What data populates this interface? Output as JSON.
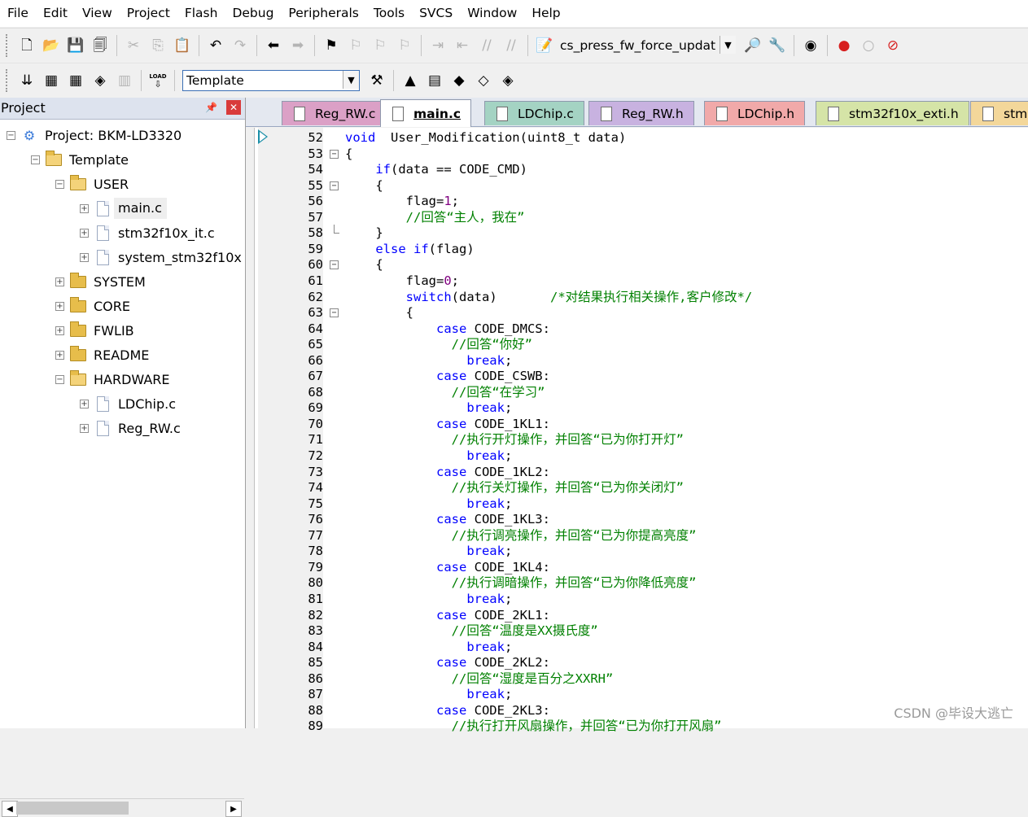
{
  "menu": [
    "File",
    "Edit",
    "View",
    "Project",
    "Flash",
    "Debug",
    "Peripherals",
    "Tools",
    "SVCS",
    "Window",
    "Help"
  ],
  "toolbar1": {
    "buttons1": [
      {
        "name": "new-file",
        "glyph": "🗋"
      },
      {
        "name": "open-folder",
        "glyph": "📂"
      },
      {
        "name": "save",
        "glyph": "💾"
      },
      {
        "name": "save-all",
        "glyph": "🗐"
      }
    ],
    "buttons2": [
      {
        "name": "cut",
        "glyph": "✂",
        "dim": true
      },
      {
        "name": "copy",
        "glyph": "⎘",
        "dim": true
      },
      {
        "name": "paste",
        "glyph": "📋"
      }
    ],
    "buttons3": [
      {
        "name": "undo",
        "glyph": "↶"
      },
      {
        "name": "redo",
        "glyph": "↷",
        "dim": true
      }
    ],
    "buttons4": [
      {
        "name": "navigate-back",
        "glyph": "⬅"
      },
      {
        "name": "navigate-forward",
        "glyph": "➡",
        "dim": true
      }
    ],
    "buttons5": [
      {
        "name": "bookmark-insert",
        "glyph": "⚑"
      },
      {
        "name": "bookmark-prev",
        "glyph": "⚐",
        "dim": true
      },
      {
        "name": "bookmark-next",
        "glyph": "⚐",
        "dim": true
      },
      {
        "name": "bookmark-clear",
        "glyph": "⚐",
        "dim": true
      }
    ],
    "buttons6": [
      {
        "name": "indent",
        "glyph": "⇥",
        "dim": true
      },
      {
        "name": "unindent",
        "glyph": "⇤",
        "dim": true
      },
      {
        "name": "comment",
        "glyph": "//",
        "dim": true
      },
      {
        "name": "uncomment",
        "glyph": "//",
        "dim": true
      }
    ],
    "build_combo_value": "cs_press_fw_force_updat",
    "buttons7": [
      {
        "name": "find-in-files",
        "glyph": "🔎"
      },
      {
        "name": "configure",
        "glyph": "🔧"
      }
    ],
    "buttons8": [
      {
        "name": "debug-session",
        "glyph": "◉"
      }
    ],
    "buttons9": [
      {
        "name": "insert-breakpoint",
        "glyph": "●",
        "color": "#d71f1f"
      },
      {
        "name": "enable-breakpoint",
        "glyph": "○",
        "dim": true
      },
      {
        "name": "kill-breakpoints",
        "glyph": "⊘",
        "color": "#d71f1f"
      }
    ]
  },
  "toolbar2": {
    "buttons1": [
      {
        "name": "translate",
        "glyph": "⇊"
      },
      {
        "name": "build",
        "glyph": "▦"
      },
      {
        "name": "rebuild",
        "glyph": "▦"
      },
      {
        "name": "batch-build",
        "glyph": "◈"
      },
      {
        "name": "stop-build",
        "glyph": "▥",
        "dim": true
      }
    ],
    "buttons2": [
      {
        "name": "download",
        "glyph": "⇩",
        "label": "LOAD"
      }
    ],
    "target_value": "Template",
    "buttons3": [
      {
        "name": "target-options",
        "glyph": "⚒"
      }
    ],
    "buttons4": [
      {
        "name": "manage-components",
        "glyph": "▲"
      },
      {
        "name": "file-extensions",
        "glyph": "▤"
      },
      {
        "name": "run-time-environment",
        "glyph": "◆"
      },
      {
        "name": "pack-installer",
        "glyph": "◇"
      },
      {
        "name": "select-packs",
        "glyph": "◈"
      }
    ]
  },
  "project_panel": {
    "title": "Project",
    "tree": [
      {
        "label": "Project: BKM-LD3320",
        "type": "project",
        "level": 0,
        "expander": "⊟"
      },
      {
        "label": "Template",
        "type": "target",
        "level": 1,
        "expander": "⊟"
      },
      {
        "label": "USER",
        "type": "folder-open",
        "level": 2,
        "expander": "⊟"
      },
      {
        "label": "main.c",
        "type": "file",
        "level": 3,
        "expander": "⊞",
        "selected": true
      },
      {
        "label": "stm32f10x_it.c",
        "type": "file",
        "level": 3,
        "expander": "⊞"
      },
      {
        "label": "system_stm32f10x",
        "type": "file",
        "level": 3,
        "expander": "⊞"
      },
      {
        "label": "SYSTEM",
        "type": "folder",
        "level": 2,
        "expander": "⊞"
      },
      {
        "label": "CORE",
        "type": "folder",
        "level": 2,
        "expander": "⊞"
      },
      {
        "label": "FWLIB",
        "type": "folder",
        "level": 2,
        "expander": "⊞"
      },
      {
        "label": "README",
        "type": "folder",
        "level": 2,
        "expander": "⊞"
      },
      {
        "label": "HARDWARE",
        "type": "folder-open",
        "level": 2,
        "expander": "⊟"
      },
      {
        "label": "LDChip.c",
        "type": "file",
        "level": 3,
        "expander": "⊞"
      },
      {
        "label": "Reg_RW.c",
        "type": "file",
        "level": 3,
        "expander": "⊞"
      }
    ]
  },
  "tabs": [
    {
      "label": "Reg_RW.c",
      "color": "#dba0c6",
      "active": false
    },
    {
      "label": "main.c",
      "color": "#ffffff",
      "active": true
    },
    {
      "label": "LDChip.c",
      "color": "#a4d3c3",
      "active": false
    },
    {
      "label": "Reg_RW.h",
      "color": "#c8b2e0",
      "active": false
    },
    {
      "label": "LDChip.h",
      "color": "#f1a9a9",
      "active": false
    },
    {
      "label": "stm32f10x_exti.h",
      "color": "#d5e4a7",
      "active": false
    },
    {
      "label": "stm",
      "color": "#f3d79a",
      "active": false
    }
  ],
  "editor": {
    "lines": [
      {
        "n": "52",
        "fold": "",
        "segs": [
          [
            "kw",
            "void"
          ],
          [
            "",
            "  User_Modification(uint8_t data)"
          ]
        ]
      },
      {
        "n": "53",
        "fold": "box",
        "segs": [
          [
            "",
            "{"
          ]
        ]
      },
      {
        "n": "54",
        "fold": "",
        "segs": [
          [
            "",
            "    "
          ],
          [
            "kw",
            "if"
          ],
          [
            "",
            "(data == CODE_CMD)"
          ]
        ]
      },
      {
        "n": "55",
        "fold": "box",
        "segs": [
          [
            "",
            "    {"
          ]
        ]
      },
      {
        "n": "56",
        "fold": "",
        "segs": [
          [
            "",
            "        flag="
          ],
          [
            "nm",
            "1"
          ],
          [
            "",
            ";"
          ]
        ]
      },
      {
        "n": "57",
        "fold": "",
        "segs": [
          [
            "",
            "        "
          ],
          [
            "cm",
            "//回答“主人，我在”"
          ]
        ]
      },
      {
        "n": "58",
        "fold": "end",
        "segs": [
          [
            "",
            "    }"
          ]
        ]
      },
      {
        "n": "59",
        "fold": "",
        "segs": [
          [
            "",
            "    "
          ],
          [
            "kw",
            "else"
          ],
          [
            "",
            " "
          ],
          [
            "kw",
            "if"
          ],
          [
            "",
            "(flag)"
          ]
        ]
      },
      {
        "n": "60",
        "fold": "box",
        "segs": [
          [
            "",
            "    {"
          ]
        ]
      },
      {
        "n": "61",
        "fold": "",
        "segs": [
          [
            "",
            "        flag="
          ],
          [
            "nm",
            "0"
          ],
          [
            "",
            ";"
          ]
        ]
      },
      {
        "n": "62",
        "fold": "",
        "segs": [
          [
            "",
            "        "
          ],
          [
            "kw",
            "switch"
          ],
          [
            "",
            "(data)       "
          ],
          [
            "cm",
            "/*对结果执行相关操作,客户修改*/"
          ]
        ]
      },
      {
        "n": "63",
        "fold": "box",
        "segs": [
          [
            "",
            "        {"
          ]
        ]
      },
      {
        "n": "64",
        "fold": "",
        "segs": [
          [
            "",
            "            "
          ],
          [
            "kw",
            "case"
          ],
          [
            "",
            " CODE_DMCS:"
          ]
        ]
      },
      {
        "n": "65",
        "fold": "",
        "segs": [
          [
            "",
            "              "
          ],
          [
            "cm",
            "//回答“你好”"
          ]
        ]
      },
      {
        "n": "66",
        "fold": "",
        "segs": [
          [
            "",
            "                "
          ],
          [
            "kw",
            "break"
          ],
          [
            "",
            ";"
          ]
        ]
      },
      {
        "n": "67",
        "fold": "",
        "segs": [
          [
            "",
            "            "
          ],
          [
            "kw",
            "case"
          ],
          [
            "",
            " CODE_CSWB:"
          ]
        ]
      },
      {
        "n": "68",
        "fold": "",
        "segs": [
          [
            "",
            "              "
          ],
          [
            "cm",
            "//回答“在学习”"
          ]
        ]
      },
      {
        "n": "69",
        "fold": "",
        "segs": [
          [
            "",
            "                "
          ],
          [
            "kw",
            "break"
          ],
          [
            "",
            ";"
          ]
        ]
      },
      {
        "n": "70",
        "fold": "",
        "segs": [
          [
            "",
            "            "
          ],
          [
            "kw",
            "case"
          ],
          [
            "",
            " CODE_1KL1:"
          ]
        ]
      },
      {
        "n": "71",
        "fold": "",
        "segs": [
          [
            "",
            "              "
          ],
          [
            "cm",
            "//执行开灯操作，并回答“已为你打开灯”"
          ]
        ]
      },
      {
        "n": "72",
        "fold": "",
        "segs": [
          [
            "",
            "                "
          ],
          [
            "kw",
            "break"
          ],
          [
            "",
            ";"
          ]
        ]
      },
      {
        "n": "73",
        "fold": "",
        "segs": [
          [
            "",
            "            "
          ],
          [
            "kw",
            "case"
          ],
          [
            "",
            " CODE_1KL2:"
          ]
        ]
      },
      {
        "n": "74",
        "fold": "",
        "segs": [
          [
            "",
            "              "
          ],
          [
            "cm",
            "//执行关灯操作，并回答“已为你关闭灯”"
          ]
        ]
      },
      {
        "n": "75",
        "fold": "",
        "segs": [
          [
            "",
            "                "
          ],
          [
            "kw",
            "break"
          ],
          [
            "",
            ";"
          ]
        ]
      },
      {
        "n": "76",
        "fold": "",
        "segs": [
          [
            "",
            "            "
          ],
          [
            "kw",
            "case"
          ],
          [
            "",
            " CODE_1KL3:"
          ]
        ]
      },
      {
        "n": "77",
        "fold": "",
        "segs": [
          [
            "",
            "              "
          ],
          [
            "cm",
            "//执行调亮操作，并回答“已为你提高亮度”"
          ]
        ]
      },
      {
        "n": "78",
        "fold": "",
        "segs": [
          [
            "",
            "                "
          ],
          [
            "kw",
            "break"
          ],
          [
            "",
            ";"
          ]
        ]
      },
      {
        "n": "79",
        "fold": "",
        "segs": [
          [
            "",
            "            "
          ],
          [
            "kw",
            "case"
          ],
          [
            "",
            " CODE_1KL4:"
          ]
        ]
      },
      {
        "n": "80",
        "fold": "",
        "segs": [
          [
            "",
            "              "
          ],
          [
            "cm",
            "//执行调暗操作，并回答“已为你降低亮度”"
          ]
        ]
      },
      {
        "n": "81",
        "fold": "",
        "segs": [
          [
            "",
            "                "
          ],
          [
            "kw",
            "break"
          ],
          [
            "",
            ";"
          ]
        ]
      },
      {
        "n": "82",
        "fold": "",
        "segs": [
          [
            "",
            "            "
          ],
          [
            "kw",
            "case"
          ],
          [
            "",
            " CODE_2KL1:"
          ]
        ]
      },
      {
        "n": "83",
        "fold": "",
        "segs": [
          [
            "",
            "              "
          ],
          [
            "cm",
            "//回答“温度是XX摄氏度”"
          ]
        ]
      },
      {
        "n": "84",
        "fold": "",
        "segs": [
          [
            "",
            "                "
          ],
          [
            "kw",
            "break"
          ],
          [
            "",
            ";"
          ]
        ]
      },
      {
        "n": "85",
        "fold": "",
        "segs": [
          [
            "",
            "            "
          ],
          [
            "kw",
            "case"
          ],
          [
            "",
            " CODE_2KL2:"
          ]
        ]
      },
      {
        "n": "86",
        "fold": "",
        "segs": [
          [
            "",
            "              "
          ],
          [
            "cm",
            "//回答“湿度是百分之XXRH”"
          ]
        ]
      },
      {
        "n": "87",
        "fold": "",
        "segs": [
          [
            "",
            "                "
          ],
          [
            "kw",
            "break"
          ],
          [
            "",
            ";"
          ]
        ]
      },
      {
        "n": "88",
        "fold": "",
        "segs": [
          [
            "",
            "            "
          ],
          [
            "kw",
            "case"
          ],
          [
            "",
            " CODE_2KL3:"
          ]
        ]
      },
      {
        "n": "89",
        "fold": "",
        "segs": [
          [
            "",
            "              "
          ],
          [
            "cm",
            "//执行打开风扇操作，并回答“已为你打开风扇”"
          ]
        ]
      }
    ]
  },
  "watermark": "CSDN @毕设大逃亡"
}
